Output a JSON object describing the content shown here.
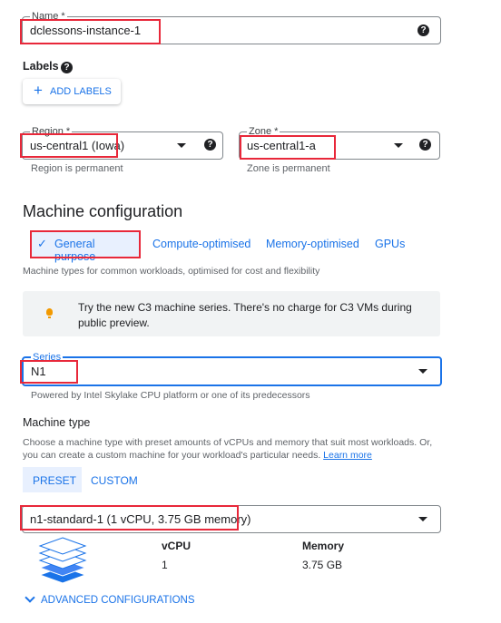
{
  "name_field": {
    "label": "Name *",
    "value": "dclessons-instance-1"
  },
  "labels": {
    "heading": "Labels",
    "add_button": "ADD LABELS"
  },
  "region": {
    "label": "Region *",
    "value": "us-central1 (Iowa)",
    "hint": "Region is permanent"
  },
  "zone": {
    "label": "Zone *",
    "value": "us-central1-a",
    "hint": "Zone is permanent"
  },
  "machine_config": {
    "title": "Machine configuration",
    "tabs": [
      {
        "label": "General purpose",
        "selected": true
      },
      {
        "label": "Compute-optimised"
      },
      {
        "label": "Memory-optimised"
      },
      {
        "label": "GPUs"
      }
    ],
    "description": "Machine types for common workloads, optimised for cost and flexibility",
    "notice": "Try the new C3 machine series. There's no charge for C3 VMs during public preview."
  },
  "series": {
    "label": "Series",
    "value": "N1",
    "hint": "Powered by Intel Skylake CPU platform or one of its predecessors"
  },
  "machine_type": {
    "heading": "Machine type",
    "description": "Choose a machine type with preset amounts of vCPUs and memory that suit most workloads. Or, you can create a custom machine for your workload's particular needs.",
    "learn_more": "Learn more",
    "tabs": [
      "PRESET",
      "CUSTOM"
    ],
    "value": "n1-standard-1 (1 vCPU, 3.75 GB memory)"
  },
  "specs": {
    "vcpu_label": "vCPU",
    "vcpu_value": "1",
    "memory_label": "Memory",
    "memory_value": "3.75 GB"
  },
  "advanced": {
    "label": "ADVANCED CONFIGURATIONS"
  },
  "colors": {
    "accent": "#1a73e8",
    "highlight": "#e8283a",
    "notice_bg": "#f1f3f4",
    "tab_selected_bg": "#e8f0fe",
    "bulb": "#f29900"
  }
}
